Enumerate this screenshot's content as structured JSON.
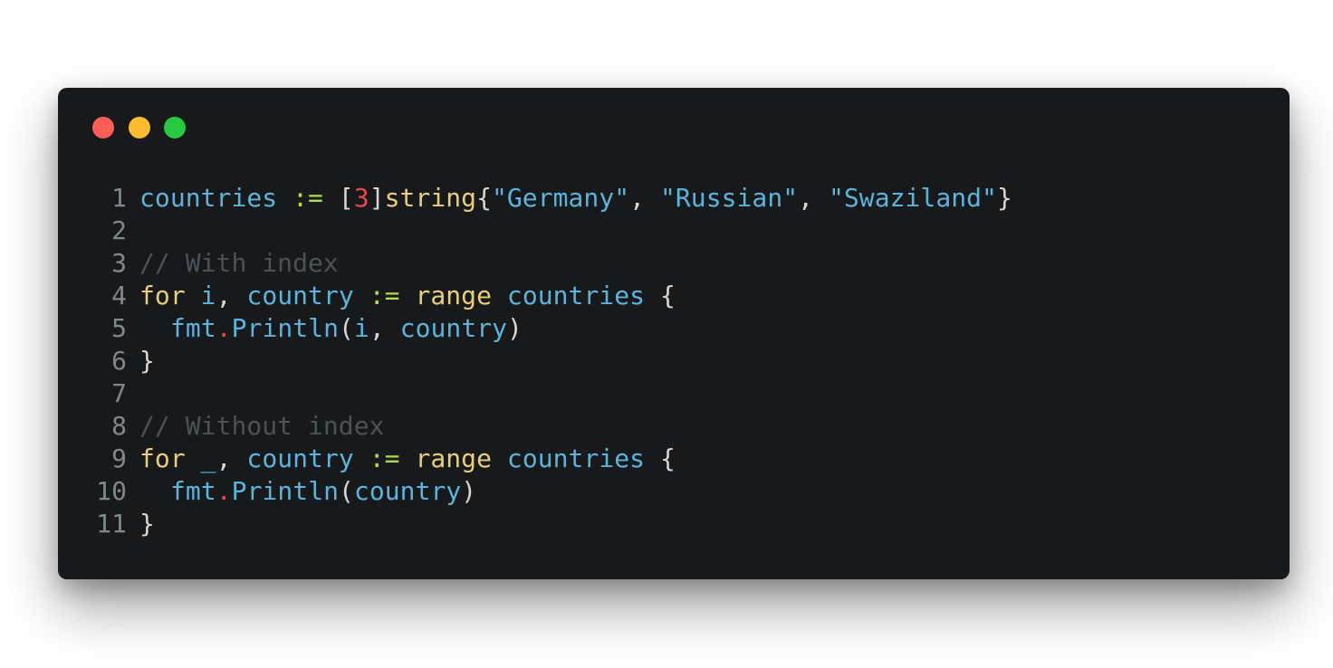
{
  "colors": {
    "page_background": "#ffffff",
    "window_background": "#18191b",
    "close_button": "#ff5f57",
    "minimize_button": "#febc2e",
    "maximize_button": "#28c840",
    "line_number": "#7d8a8a",
    "identifier": "#5ab4dc",
    "keyword": "#e8cf7a",
    "string": "#5ab4dc",
    "number": "#e5484d",
    "operator": "#b2d94e",
    "punctuation": "#d6d6d6",
    "comment": "#49535a",
    "dot": "#e5484d"
  },
  "window": {
    "close_icon": "red-circle",
    "minimize_icon": "yellow-circle",
    "maximize_icon": "green-circle"
  },
  "code": {
    "lines": [
      {
        "number": "1",
        "tokens": [
          {
            "text": "countries",
            "type": "identifier"
          },
          {
            "text": " ",
            "type": "space"
          },
          {
            "text": ":=",
            "type": "operator"
          },
          {
            "text": " ",
            "type": "space"
          },
          {
            "text": "[",
            "type": "punctuation"
          },
          {
            "text": "3",
            "type": "number"
          },
          {
            "text": "]",
            "type": "punctuation"
          },
          {
            "text": "string",
            "type": "keyword"
          },
          {
            "text": "{",
            "type": "punctuation"
          },
          {
            "text": "\"Germany\"",
            "type": "string"
          },
          {
            "text": ", ",
            "type": "punctuation"
          },
          {
            "text": "\"Russian\"",
            "type": "string"
          },
          {
            "text": ", ",
            "type": "punctuation"
          },
          {
            "text": "\"Swaziland\"",
            "type": "string"
          },
          {
            "text": "}",
            "type": "punctuation"
          }
        ]
      },
      {
        "number": "2",
        "tokens": []
      },
      {
        "number": "3",
        "tokens": [
          {
            "text": "// With index",
            "type": "comment"
          }
        ]
      },
      {
        "number": "4",
        "tokens": [
          {
            "text": "for",
            "type": "keyword"
          },
          {
            "text": " ",
            "type": "space"
          },
          {
            "text": "i",
            "type": "identifier"
          },
          {
            "text": ", ",
            "type": "punctuation"
          },
          {
            "text": "country",
            "type": "identifier"
          },
          {
            "text": " ",
            "type": "space"
          },
          {
            "text": ":=",
            "type": "operator"
          },
          {
            "text": " ",
            "type": "space"
          },
          {
            "text": "range",
            "type": "keyword"
          },
          {
            "text": " ",
            "type": "space"
          },
          {
            "text": "countries",
            "type": "identifier"
          },
          {
            "text": " ",
            "type": "space"
          },
          {
            "text": "{",
            "type": "punctuation"
          }
        ]
      },
      {
        "number": "5",
        "indent": true,
        "tokens": [
          {
            "text": "fmt",
            "type": "identifier"
          },
          {
            "text": ".",
            "type": "dot"
          },
          {
            "text": "Println",
            "type": "identifier"
          },
          {
            "text": "(",
            "type": "punctuation"
          },
          {
            "text": "i",
            "type": "identifier"
          },
          {
            "text": ", ",
            "type": "punctuation"
          },
          {
            "text": "country",
            "type": "identifier"
          },
          {
            "text": ")",
            "type": "punctuation"
          }
        ]
      },
      {
        "number": "6",
        "tokens": [
          {
            "text": "}",
            "type": "punctuation"
          }
        ]
      },
      {
        "number": "7",
        "tokens": []
      },
      {
        "number": "8",
        "tokens": [
          {
            "text": "// Without index",
            "type": "comment"
          }
        ]
      },
      {
        "number": "9",
        "tokens": [
          {
            "text": "for",
            "type": "keyword"
          },
          {
            "text": " ",
            "type": "space"
          },
          {
            "text": "_",
            "type": "identifier"
          },
          {
            "text": ", ",
            "type": "punctuation"
          },
          {
            "text": "country",
            "type": "identifier"
          },
          {
            "text": " ",
            "type": "space"
          },
          {
            "text": ":=",
            "type": "operator"
          },
          {
            "text": " ",
            "type": "space"
          },
          {
            "text": "range",
            "type": "keyword"
          },
          {
            "text": " ",
            "type": "space"
          },
          {
            "text": "countries",
            "type": "identifier"
          },
          {
            "text": " ",
            "type": "space"
          },
          {
            "text": "{",
            "type": "punctuation"
          }
        ]
      },
      {
        "number": "10",
        "indent": true,
        "tokens": [
          {
            "text": "fmt",
            "type": "identifier"
          },
          {
            "text": ".",
            "type": "dot"
          },
          {
            "text": "Println",
            "type": "identifier"
          },
          {
            "text": "(",
            "type": "punctuation"
          },
          {
            "text": "country",
            "type": "identifier"
          },
          {
            "text": ")",
            "type": "punctuation"
          }
        ]
      },
      {
        "number": "11",
        "tokens": [
          {
            "text": "}",
            "type": "punctuation"
          }
        ]
      }
    ]
  }
}
